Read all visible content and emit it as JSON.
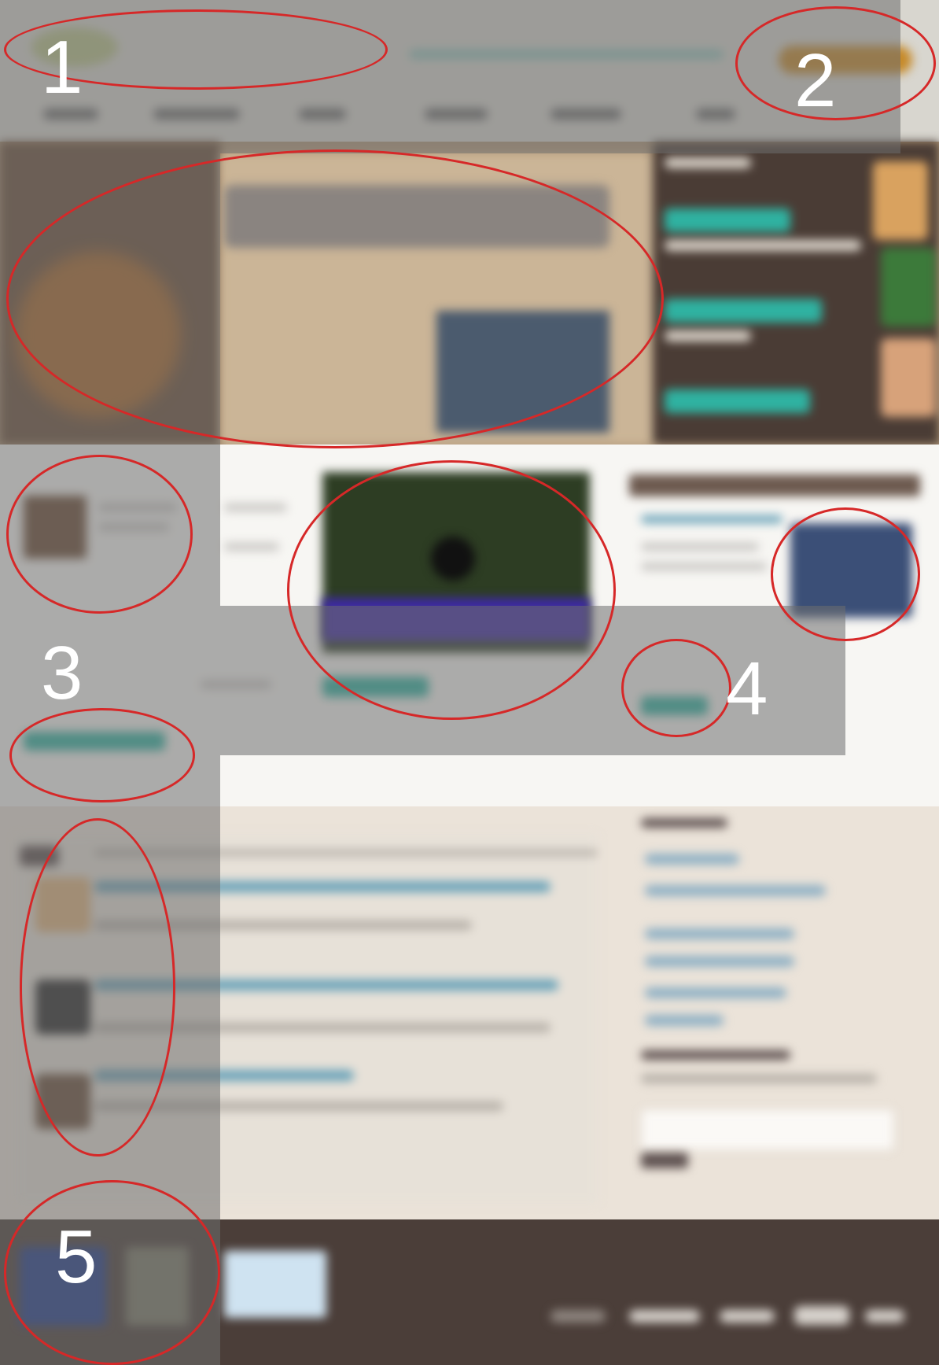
{
  "annotations": {
    "label_1": "1",
    "label_2": "2",
    "label_3": "3",
    "label_4": "4",
    "label_5": "5"
  },
  "colors": {
    "highlight": "#d62828",
    "brand_teal": "#2c9b8c",
    "accent_button": "#2fb2a1",
    "header_cta": "#c68a2a",
    "footer_bg": "#4b3e39"
  }
}
